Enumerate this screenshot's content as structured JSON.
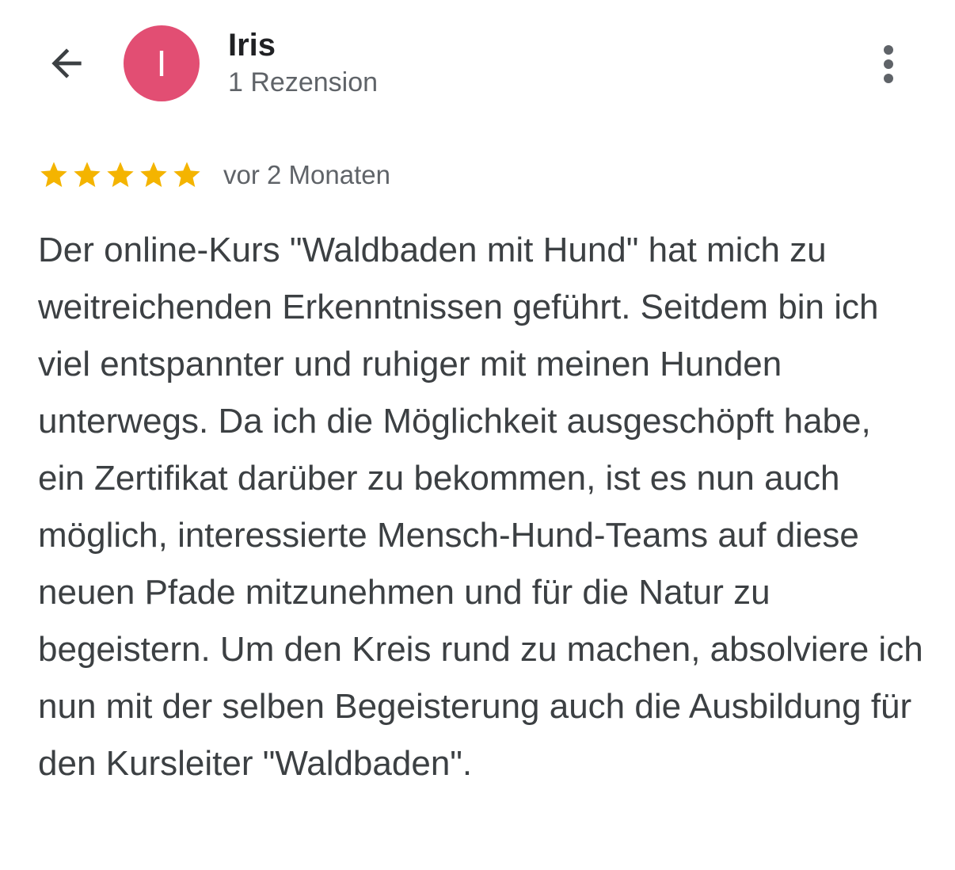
{
  "header": {
    "back_icon": "arrow-back-icon",
    "avatar_letter": "I",
    "avatar_color": "#e24e73",
    "reviewer_name": "Iris",
    "reviewer_meta": "1 Rezension",
    "more_icon": "more-vert-icon"
  },
  "review": {
    "rating": 5,
    "rating_max": 5,
    "star_color": "#f4b400",
    "date": "vor 2 Monaten",
    "text": "Der online-Kurs \"Waldbaden mit Hund\" hat mich zu weitreichenden Erkenntnissen geführt. Seitdem bin ich viel entspannter und ruhiger mit meinen Hunden unterwegs. Da ich die Möglichkeit ausgeschöpft habe, ein Zertifikat darüber zu bekommen, ist es nun auch möglich, interessierte Mensch-Hund-Teams auf diese neuen Pfade mitzunehmen und für die Natur zu begeistern. Um den Kreis rund zu machen, absolviere ich nun mit der selben Begeisterung auch die Ausbildung für den Kursleiter \"Waldbaden\"."
  }
}
